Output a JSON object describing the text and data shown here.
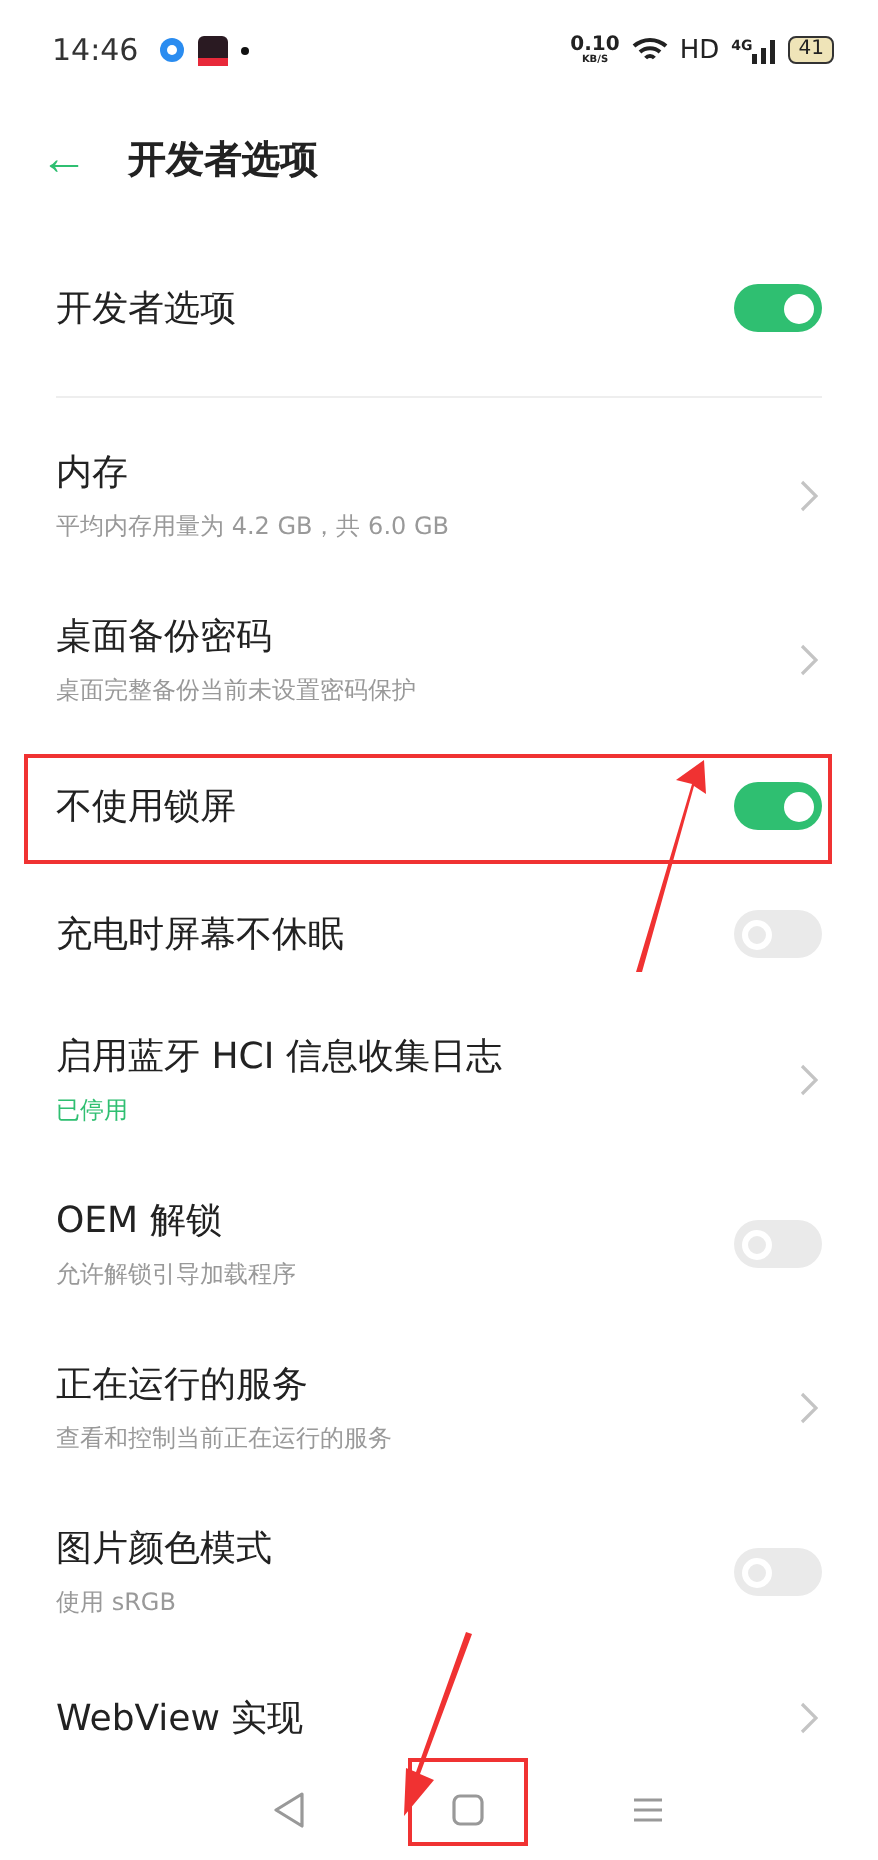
{
  "status_bar": {
    "time": "14:46",
    "speed": "0.10",
    "speed_unit": "KB/S",
    "network": "HD",
    "cell": "4G",
    "battery": "41"
  },
  "header": {
    "back": "←",
    "title": "开发者选项"
  },
  "master": {
    "label": "开发者选项",
    "on": true
  },
  "items": [
    {
      "kind": "link",
      "title": "内存",
      "subtitle": "平均内存用量为 4.2 GB，共 6.0 GB"
    },
    {
      "kind": "link",
      "title": "桌面备份密码",
      "subtitle": "桌面完整备份当前未设置密码保护"
    },
    {
      "kind": "toggle",
      "title": "不使用锁屏",
      "on": true,
      "highlighted": true
    },
    {
      "kind": "toggle",
      "title": "充电时屏幕不休眠",
      "on": false
    },
    {
      "kind": "link",
      "title": "启用蓝牙 HCI 信息收集日志",
      "subtitle": "已停用",
      "accent": true
    },
    {
      "kind": "toggle",
      "title": "OEM 解锁",
      "subtitle": "允许解锁引导加载程序",
      "on": false
    },
    {
      "kind": "link",
      "title": "正在运行的服务",
      "subtitle": "查看和控制当前正在运行的服务"
    },
    {
      "kind": "toggle",
      "title": "图片颜色模式",
      "subtitle": "使用 sRGB",
      "on": false
    },
    {
      "kind": "link",
      "title": "WebView 实现"
    }
  ],
  "nav": {
    "home_highlighted": true
  }
}
